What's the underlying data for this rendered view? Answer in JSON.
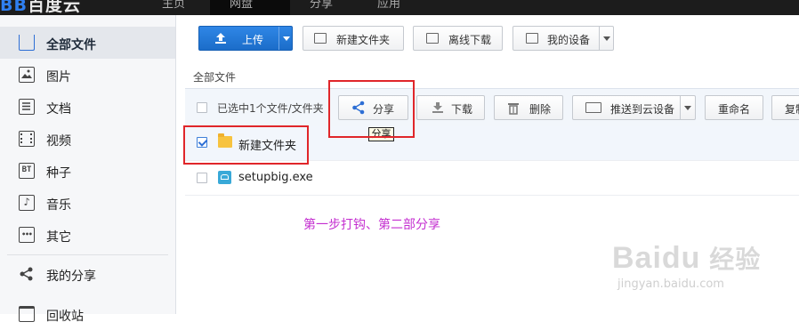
{
  "app": {
    "logo_text": "百度云",
    "logo_mark": "BB"
  },
  "topnav": [
    {
      "label": "主页"
    },
    {
      "label": "网盘"
    },
    {
      "label": "分享"
    },
    {
      "label": "应用"
    }
  ],
  "sidebar": {
    "items": [
      {
        "label": "全部文件",
        "icon": "folder-tray-icon"
      },
      {
        "label": "图片",
        "icon": "image-icon"
      },
      {
        "label": "文档",
        "icon": "document-icon"
      },
      {
        "label": "视频",
        "icon": "video-icon"
      },
      {
        "label": "种子",
        "icon": "bt-icon",
        "icon_text": "BT"
      },
      {
        "label": "音乐",
        "icon": "music-icon",
        "icon_text": "♪"
      },
      {
        "label": "其它",
        "icon": "more-icon",
        "icon_text": "•••"
      },
      {
        "label": "我的分享",
        "icon": "share-icon"
      },
      {
        "label": "回收站",
        "icon": "trash-icon"
      }
    ]
  },
  "toolbar": {
    "upload": "上传",
    "new_folder": "新建文件夹",
    "offline_download": "离线下载",
    "my_devices": "我的设备"
  },
  "breadcrumb": "全部文件",
  "actions": {
    "selection_text": "已选中1个文件/文件夹",
    "share": "分享",
    "download": "下载",
    "delete": "删除",
    "push_to_device": "推送到云设备",
    "rename": "重命名",
    "copy": "复制"
  },
  "tooltip": "分享",
  "files": [
    {
      "name": "新建文件夹",
      "type": "folder",
      "checked": true
    },
    {
      "name": "setupbig.exe",
      "type": "exe",
      "checked": false
    }
  ],
  "annotation": "第一步打钩、第二部分享",
  "watermark": {
    "logo": "Baidu",
    "logo_suffix": "经验",
    "sub": "jingyan.baidu.com"
  },
  "colors": {
    "accent": "#2e6fd5",
    "highlight": "#e0262a",
    "annotation": "#c42fd0"
  }
}
